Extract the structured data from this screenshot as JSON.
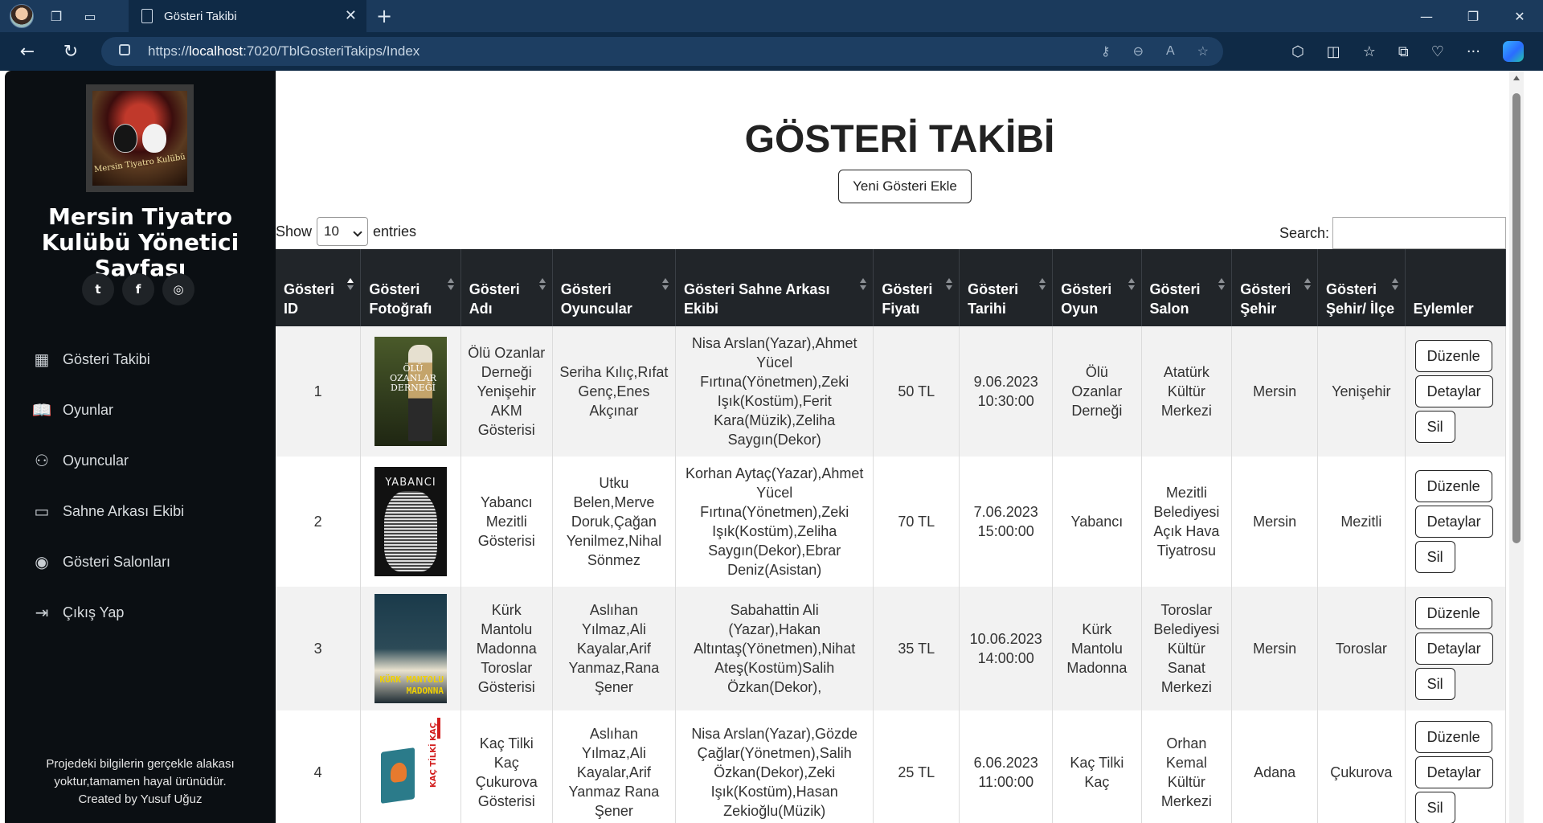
{
  "browser": {
    "tab_title": "Gösteri Takibi",
    "url_prefix": "https://",
    "url_host": "localhost",
    "url_rest": ":7020/TblGosteriTakips/Index"
  },
  "sidebar": {
    "logo_text": "Mersin Tiyatro Kulübü",
    "title": "Mersin Tiyatro Kulübü Yönetici Sayfası",
    "menu": [
      {
        "label": "Gösteri Takibi",
        "icon": "calendar-icon"
      },
      {
        "label": "Oyunlar",
        "icon": "book-icon"
      },
      {
        "label": "Oyuncular",
        "icon": "person-icon"
      },
      {
        "label": "Sahne Arkası Ekibi",
        "icon": "camera-icon"
      },
      {
        "label": "Gösteri Salonları",
        "icon": "location-icon"
      },
      {
        "label": "Çıkış Yap",
        "icon": "logout-icon"
      }
    ],
    "footer_line1": "Projedeki bilgilerin gerçekle alakası",
    "footer_line2": "yoktur,tamamen hayal ürünüdür.",
    "footer_line3": "Created by Yusuf Uğuz"
  },
  "main": {
    "title": "GÖSTERİ TAKİBİ",
    "add_button": "Yeni Gösteri Ekle",
    "show_label": "Show",
    "entries_value": "10",
    "entries_label": "entries",
    "search_label": "Search:",
    "columns": [
      "Gösteri ID",
      "Gösteri Fotoğrafı",
      "Gösteri Adı",
      "Gösteri Oyuncular",
      "Gösteri Sahne Arkası Ekibi",
      "Gösteri Fiyatı",
      "Gösteri Tarihi",
      "Gösteri Oyun",
      "Gösteri Salon",
      "Gösteri Şehir",
      "Gösteri Şehir/ İlçe",
      "Eylemler"
    ],
    "actions": {
      "edit": "Düzenle",
      "details": "Detaylar",
      "delete": "Sil"
    },
    "rows": [
      {
        "id": "1",
        "poster_text": "ÖLÜ OZANLAR DERNEĞİ",
        "name": "Ölü Ozanlar Derneği Yenişehir AKM Gösterisi",
        "actors": "Seriha Kılıç,Rıfat Genç,Enes Akçınar",
        "crew": "Nisa Arslan(Yazar),Ahmet Yücel Fırtına(Yönetmen),Zeki Işık(Kostüm),Ferit Kara(Müzik),Zeliha Saygın(Dekor)",
        "price": "50 TL",
        "date": "9.06.2023 10:30:00",
        "play": "Ölü Ozanlar Derneği",
        "venue": "Atatürk Kültür Merkezi",
        "city": "Mersin",
        "district": "Yenişehir"
      },
      {
        "id": "2",
        "poster_text": "YABANCI",
        "name": "Yabancı Mezitli Gösterisi",
        "actors": "Utku Belen,Merve Doruk,Çağan Yenilmez,Nihal Sönmez",
        "crew": "Korhan Aytaç(Yazar),Ahmet Yücel Fırtına(Yönetmen),Zeki Işık(Kostüm),Zeliha Saygın(Dekor),Ebrar Deniz(Asistan)",
        "price": "70 TL",
        "date": "7.06.2023 15:00:00",
        "play": "Yabancı",
        "venue": "Mezitli Belediyesi Açık Hava Tiyatrosu",
        "city": "Mersin",
        "district": "Mezitli"
      },
      {
        "id": "3",
        "poster_text": "KÜRK MANTOLU MADONNA",
        "name": "Kürk Mantolu Madonna Toroslar Gösterisi",
        "actors": "Aslıhan Yılmaz,Ali Kayalar,Arif Yanmaz,Rana Şener",
        "crew": "Sabahattin Ali (Yazar),Hakan Altıntaş(Yönetmen),Nihat Ateş(Kostüm)Salih Özkan(Dekor),",
        "price": "35 TL",
        "date": "10.06.2023 14:00:00",
        "play": "Kürk Mantolu Madonna",
        "venue": "Toroslar Belediyesi Kültür Sanat Merkezi",
        "city": "Mersin",
        "district": "Toroslar"
      },
      {
        "id": "4",
        "poster_text": "KAÇ TİLKİ KAÇ",
        "name": "Kaç Tilki Kaç Çukurova Gösterisi",
        "actors": "Aslıhan Yılmaz,Ali Kayalar,Arif Yanmaz Rana Şener",
        "crew": "Nisa Arslan(Yazar),Gözde Çağlar(Yönetmen),Salih Özkan(Dekor),Zeki Işık(Kostüm),Hasan Zekioğlu(Müzik)",
        "price": "25 TL",
        "date": "6.06.2023 11:00:00",
        "play": "Kaç Tilki Kaç",
        "venue": "Orhan Kemal Kültür Merkezi",
        "city": "Adana",
        "district": "Çukurova"
      }
    ]
  },
  "colors": {
    "sidebar_bg": "#0b0f13",
    "table_header_bg": "#212529",
    "row_stripe": "#f2f2f2",
    "chrome_bg": "#1b3a5c"
  }
}
